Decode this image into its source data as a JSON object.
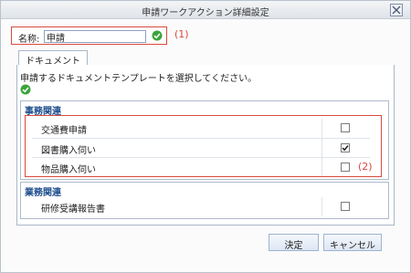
{
  "dialog": {
    "title": "申請ワークアクション詳細設定",
    "close_icon": "close-icon"
  },
  "name_field": {
    "label": "名称:",
    "value": "申請",
    "marker": "(1)"
  },
  "tab": {
    "label": "ドキュメント"
  },
  "instruction": "申請するドキュメントテンプレートを選択してください。",
  "groups": [
    {
      "title": "事務関連",
      "items": [
        {
          "label": "交通費申請",
          "checked": false
        },
        {
          "label": "図書購入伺い",
          "checked": true
        },
        {
          "label": "物品購入伺い",
          "checked": false
        }
      ],
      "marker": "(2)"
    },
    {
      "title": "業務関連",
      "items": [
        {
          "label": "研修受講報告書",
          "checked": false
        }
      ]
    }
  ],
  "buttons": {
    "ok": "決定",
    "cancel": "キャンセル"
  },
  "colors": {
    "annotation_red": "#d94a3f",
    "group_title_blue": "#1f4f8f",
    "ok_green": "#3aa43a"
  }
}
